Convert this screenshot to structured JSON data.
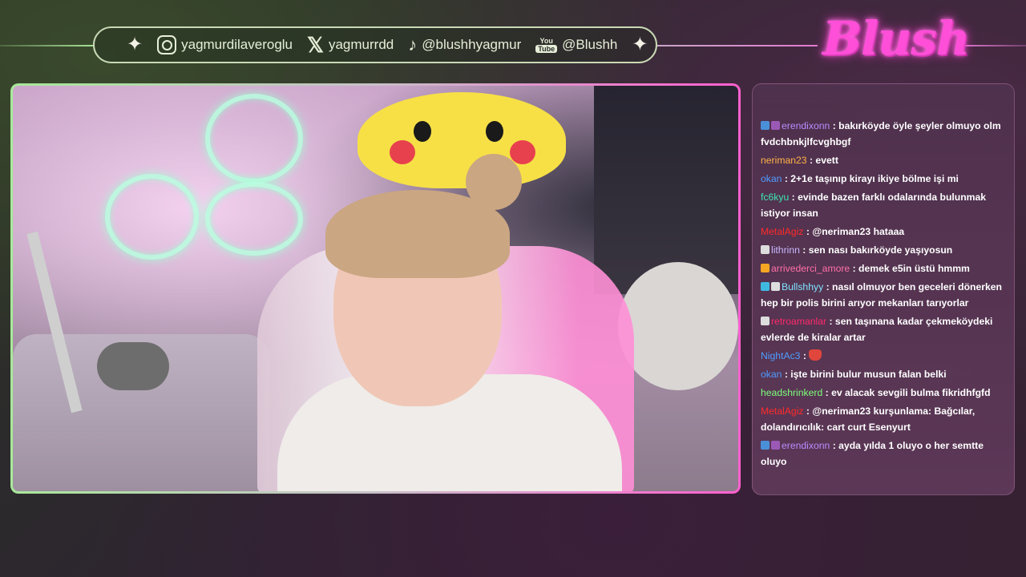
{
  "social": {
    "instagram": "yagmurdilaveroglu",
    "x": "yagmurrdd",
    "tiktok": "@blushhyagmur",
    "youtube": "@Blushh",
    "youtube_icon_top": "You",
    "youtube_icon_bottom": "Tube"
  },
  "logo": "Blush",
  "chat": {
    "messages": [
      {
        "user": "erendixonn",
        "color": "#b98cff",
        "badges": [
          "#4a90d9",
          "#9b59b6"
        ],
        "text": ": bakırköyde öyle şeyler olmuyo olm fvdchbnkjlfcvghbgf"
      },
      {
        "user": "neriman23",
        "color": "#ffb347",
        "badges": [],
        "text": ": evett"
      },
      {
        "user": "okan",
        "color": "#4f9cff",
        "badges": [],
        "text": ": 2+1e taşınıp kirayı ikiye bölme işi mi"
      },
      {
        "user": "fc6kyu",
        "color": "#3ee6b0",
        "badges": [],
        "text": ": evinde bazen farklı odalarında bulunmak istiyor insan"
      },
      {
        "user": "MetalAgiz",
        "color": "#ff2a2a",
        "badges": [],
        "text": ": @neriman23 hataaa"
      },
      {
        "user": "lithrinn",
        "color": "#c9b8ff",
        "badges": [
          "#dddddd"
        ],
        "text": ": sen nası bakırköyde yaşıyosun"
      },
      {
        "user": "arrivederci_amore",
        "color": "#ff6fa8",
        "badges": [
          "#f5a623"
        ],
        "text": ": demek e5in üstü hmmm"
      },
      {
        "user": "Bullshhyy",
        "color": "#7fe3ff",
        "badges": [
          "#3fb8e0",
          "#dddddd"
        ],
        "text": ": nasıl olmuyor ben geceleri dönerken hep bir polis birini arıyor mekanları tarıyorlar"
      },
      {
        "user": "retroamanlar",
        "color": "#ff2a6a",
        "badges": [
          "#dddddd"
        ],
        "text": ": sen taşınana kadar çekmeköydeki evlerde de kiralar artar"
      },
      {
        "user": "NightAc3",
        "color": "#4f9cff",
        "badges": [],
        "text": ":",
        "emote": true
      },
      {
        "user": "okan",
        "color": "#4f9cff",
        "badges": [],
        "text": ": işte birini bulur musun falan belki"
      },
      {
        "user": "headshrinkerd",
        "color": "#7dff7a",
        "badges": [],
        "text": ": ev alacak sevgili bulma fikridhfgfd"
      },
      {
        "user": "MetalAgiz",
        "color": "#ff2a2a",
        "badges": [],
        "text": ": @neriman23 kurşunlama: Bağcılar, dolandırıcılık: cart curt Esenyurt"
      },
      {
        "user": "erendixonn",
        "color": "#b98cff",
        "badges": [
          "#4a90d9",
          "#9b59b6"
        ],
        "text": ": ayda yılda 1 oluyo o her semtte oluyo"
      }
    ]
  }
}
